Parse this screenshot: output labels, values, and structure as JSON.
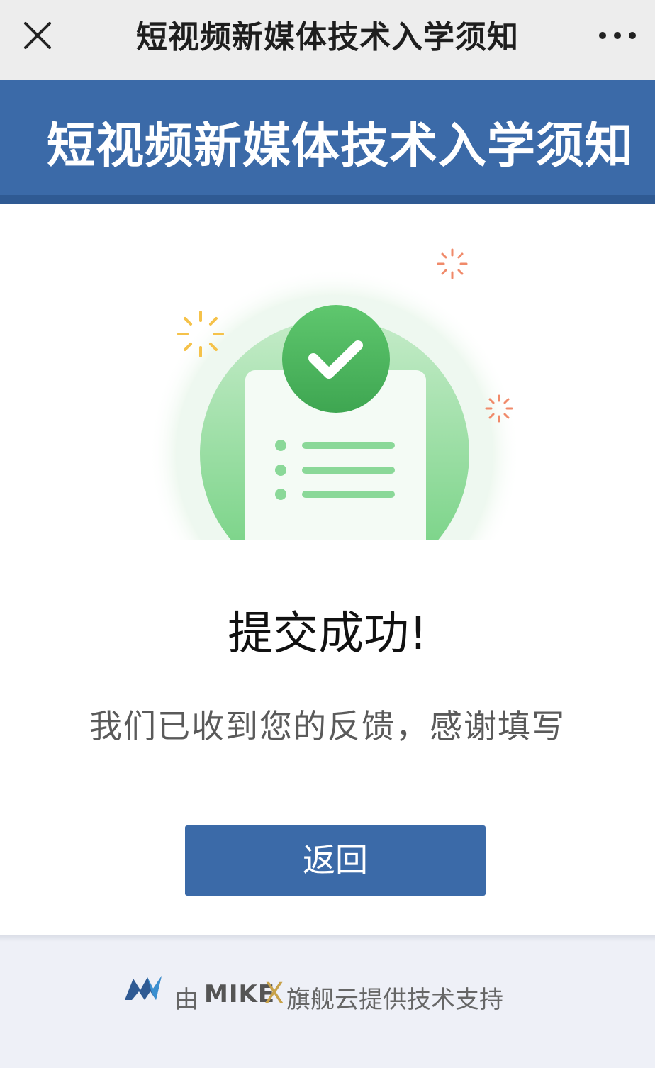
{
  "nav": {
    "title": "短视频新媒体技术入学须知",
    "close_icon": "close-icon",
    "more_icon": "more-dots-icon"
  },
  "banner": {
    "title": "短视频新媒体技术入学须知",
    "color": "#3b6aa8"
  },
  "result": {
    "illustration_icon": "checkmark-document-icon",
    "title": "提交成功!",
    "message": "我们已收到您的反馈，感谢填写",
    "back_label": "返回"
  },
  "footer": {
    "prefix": "由",
    "brand_main": "MIKE",
    "brand_x": "X",
    "suffix": "旗舰云提供技术支持",
    "logo_icon": "mikex-logo-icon"
  }
}
